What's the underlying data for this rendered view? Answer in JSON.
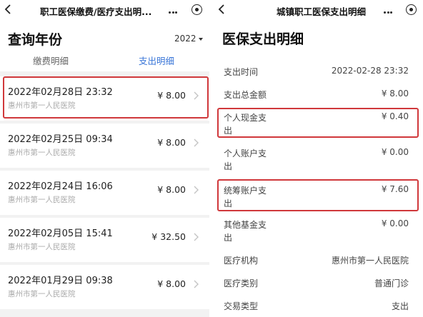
{
  "left": {
    "nav": {
      "title": "职工医保缴费/医疗支出明..."
    },
    "header": {
      "title": "查询年份",
      "year": "2022"
    },
    "tabs": [
      {
        "label": "缴费明细",
        "active": false
      },
      {
        "label": "支出明细",
        "active": true
      }
    ],
    "records": [
      {
        "datetime": "2022年02月28日 23:32",
        "hospital": "惠州市第一人民医院",
        "amount": "¥ 8.00"
      },
      {
        "datetime": "2022年02月25日 09:34",
        "hospital": "惠州市第一人民医院",
        "amount": "¥ 8.00"
      },
      {
        "datetime": "2022年02月24日 16:06",
        "hospital": "惠州市第一人民医院",
        "amount": "¥ 8.00"
      },
      {
        "datetime": "2022年02月05日 15:41",
        "hospital": "惠州市第一人民医院",
        "amount": "¥ 32.50"
      },
      {
        "datetime": "2022年01月29日 09:38",
        "hospital": "惠州市第一人民医院",
        "amount": "¥ 8.00"
      }
    ]
  },
  "right": {
    "nav": {
      "title": "城镇职工医保支出明细"
    },
    "title": "医保支出明细",
    "rows": [
      {
        "label": "支出时间",
        "value": "2022-02-28 23:32"
      },
      {
        "label": "支出总金额",
        "value": "¥ 8.00"
      },
      {
        "label_line1": "个人现金支",
        "label_line2": "出",
        "value": "¥ 0.40"
      },
      {
        "label_line1": "个人账户支",
        "label_line2": "出",
        "value": "¥ 0.00"
      },
      {
        "label_line1": "统筹账户支",
        "label_line2": "出",
        "value": "¥ 7.60"
      },
      {
        "label_line1": "其他基金支",
        "label_line2": "出",
        "value": "¥ 0.00"
      },
      {
        "label": "医疗机构",
        "value": "惠州市第一人民医院"
      },
      {
        "label": "医疗类别",
        "value": "普通门诊"
      },
      {
        "label": "交易类型",
        "value": "支出"
      }
    ]
  },
  "colors": {
    "highlight": "#d0383b",
    "active_tab": "#3a76d8",
    "muted": "#aaaaaa"
  },
  "icons": [
    "back-icon",
    "more-icon",
    "target-icon",
    "chevron-right-icon",
    "caret-down-icon"
  ]
}
